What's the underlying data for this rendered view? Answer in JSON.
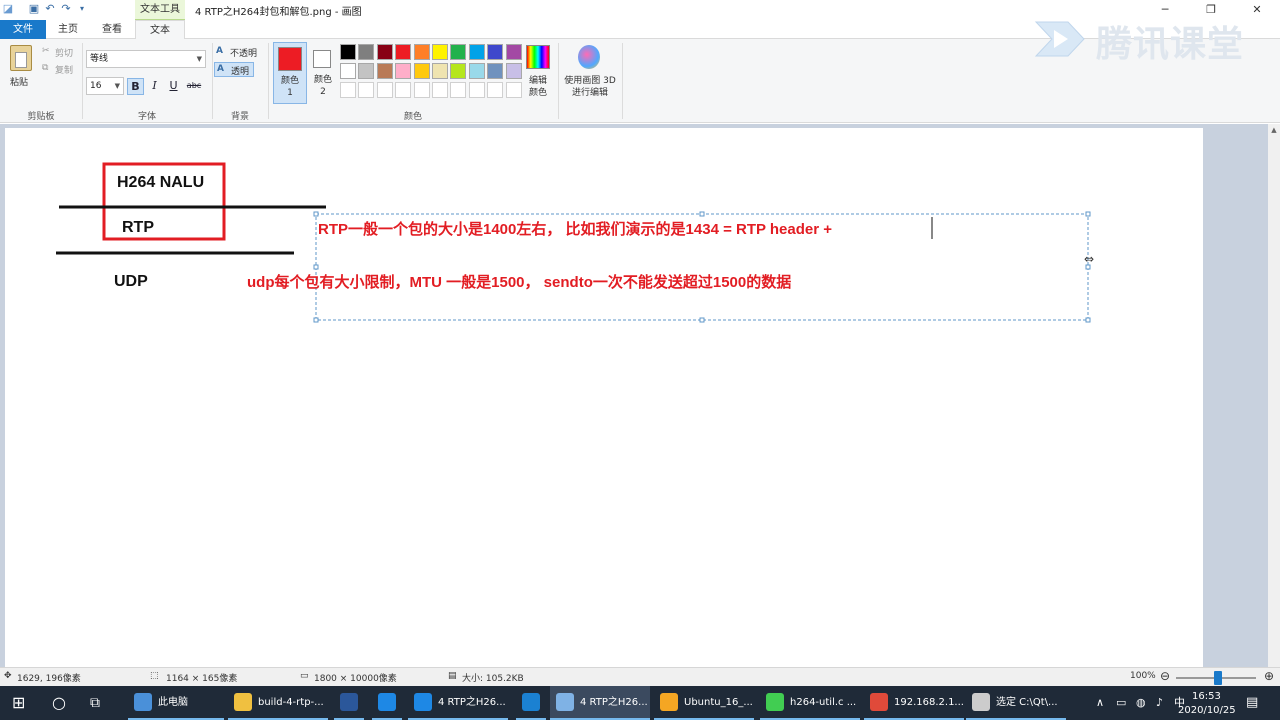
{
  "window": {
    "title": "4 RTP之H264封包和解包.png - 画图",
    "contextual_tab": "文本工具",
    "minimize": "─",
    "maximize": "❐",
    "close": "✕"
  },
  "tabs": [
    "文件",
    "主页",
    "查看",
    "文本"
  ],
  "ribbon": {
    "clipboard": {
      "label": "剪贴板",
      "paste": "粘贴",
      "cut": "剪切",
      "copy": "复制"
    },
    "font": {
      "label": "字体",
      "family": "等线",
      "size": "16",
      "bold": "B",
      "italic": "I",
      "underline": "U",
      "strikethrough": "abc"
    },
    "background": {
      "label": "背景",
      "opaque": "不透明",
      "transparent": "透明"
    },
    "colors": {
      "label": "颜色",
      "color1_label": "颜色 1",
      "color2_label": "颜色 2",
      "color1_value": "#ed1c24",
      "color2_value": "#ffffff",
      "edit_colors": "编辑颜色",
      "palette_row1": [
        "#000000",
        "#7f7f7f",
        "#880015",
        "#ed1c24",
        "#ff7f27",
        "#fff200",
        "#22b14c",
        "#00a2e8",
        "#3f48cc",
        "#a349a4"
      ],
      "palette_row2": [
        "#ffffff",
        "#c3c3c3",
        "#b97a57",
        "#ffaec9",
        "#ffc90e",
        "#efe4b0",
        "#b5e61d",
        "#99d9ea",
        "#7092be",
        "#c8bfe7"
      ],
      "palette_row3": [
        "#ffffff",
        "#ffffff",
        "#ffffff",
        "#ffffff",
        "#ffffff",
        "#ffffff",
        "#ffffff",
        "#ffffff",
        "#ffffff",
        "#ffffff"
      ]
    },
    "paint3d": "使用画图 3D 进行编辑"
  },
  "watermark": "腾讯课堂",
  "canvas": {
    "label_nalu": "H264 NALU",
    "label_rtp": "RTP",
    "label_udp": "UDP",
    "note_rtp": "RTP一般一个包的大小是1400左右， 比如我们演示的是1434 = RTP header +",
    "note_udp": "udp每个包有大小限制，MTU 一般是1500， sendto一次不能发送超过1500的数据"
  },
  "status": {
    "cursor_pos": "1629, 196像素",
    "selection_size": "1164 × 165像素",
    "image_size": "1800 × 10000像素",
    "file_size": "大小: 105.2KB",
    "zoom": "100%",
    "zoom_level_percent": 100
  },
  "taskbar": {
    "items": [
      {
        "label": "此电脑",
        "icon": "computer-icon",
        "color": "#4a90d9"
      },
      {
        "label": "build-4-rtp-...",
        "icon": "folder-icon",
        "color": "#f0c040"
      },
      {
        "label": "",
        "icon": "word-icon",
        "color": "#2b579a"
      },
      {
        "label": "",
        "icon": "sogou-icon",
        "color": "#1e88e5"
      },
      {
        "label": "4 RTP之H26...",
        "icon": "sogou-icon",
        "color": "#1e88e5"
      },
      {
        "label": "",
        "icon": "vscode-icon",
        "color": "#1b81d2"
      },
      {
        "label": "4 RTP之H26...",
        "icon": "paint-icon",
        "color": "#7fb2e5"
      },
      {
        "label": "Ubuntu_16_...",
        "icon": "vm-icon",
        "color": "#f5a623"
      },
      {
        "label": "h264-util.c ...",
        "icon": "qt-icon",
        "color": "#41cd52"
      },
      {
        "label": "192.168.2.1...",
        "icon": "terminal-icon",
        "color": "#e04a3a"
      },
      {
        "label": "选定 C:\\Qt\\...",
        "icon": "cmd-icon",
        "color": "#cccccc"
      }
    ],
    "time": "16:53",
    "date": "2020/10/25",
    "ime": "中"
  }
}
